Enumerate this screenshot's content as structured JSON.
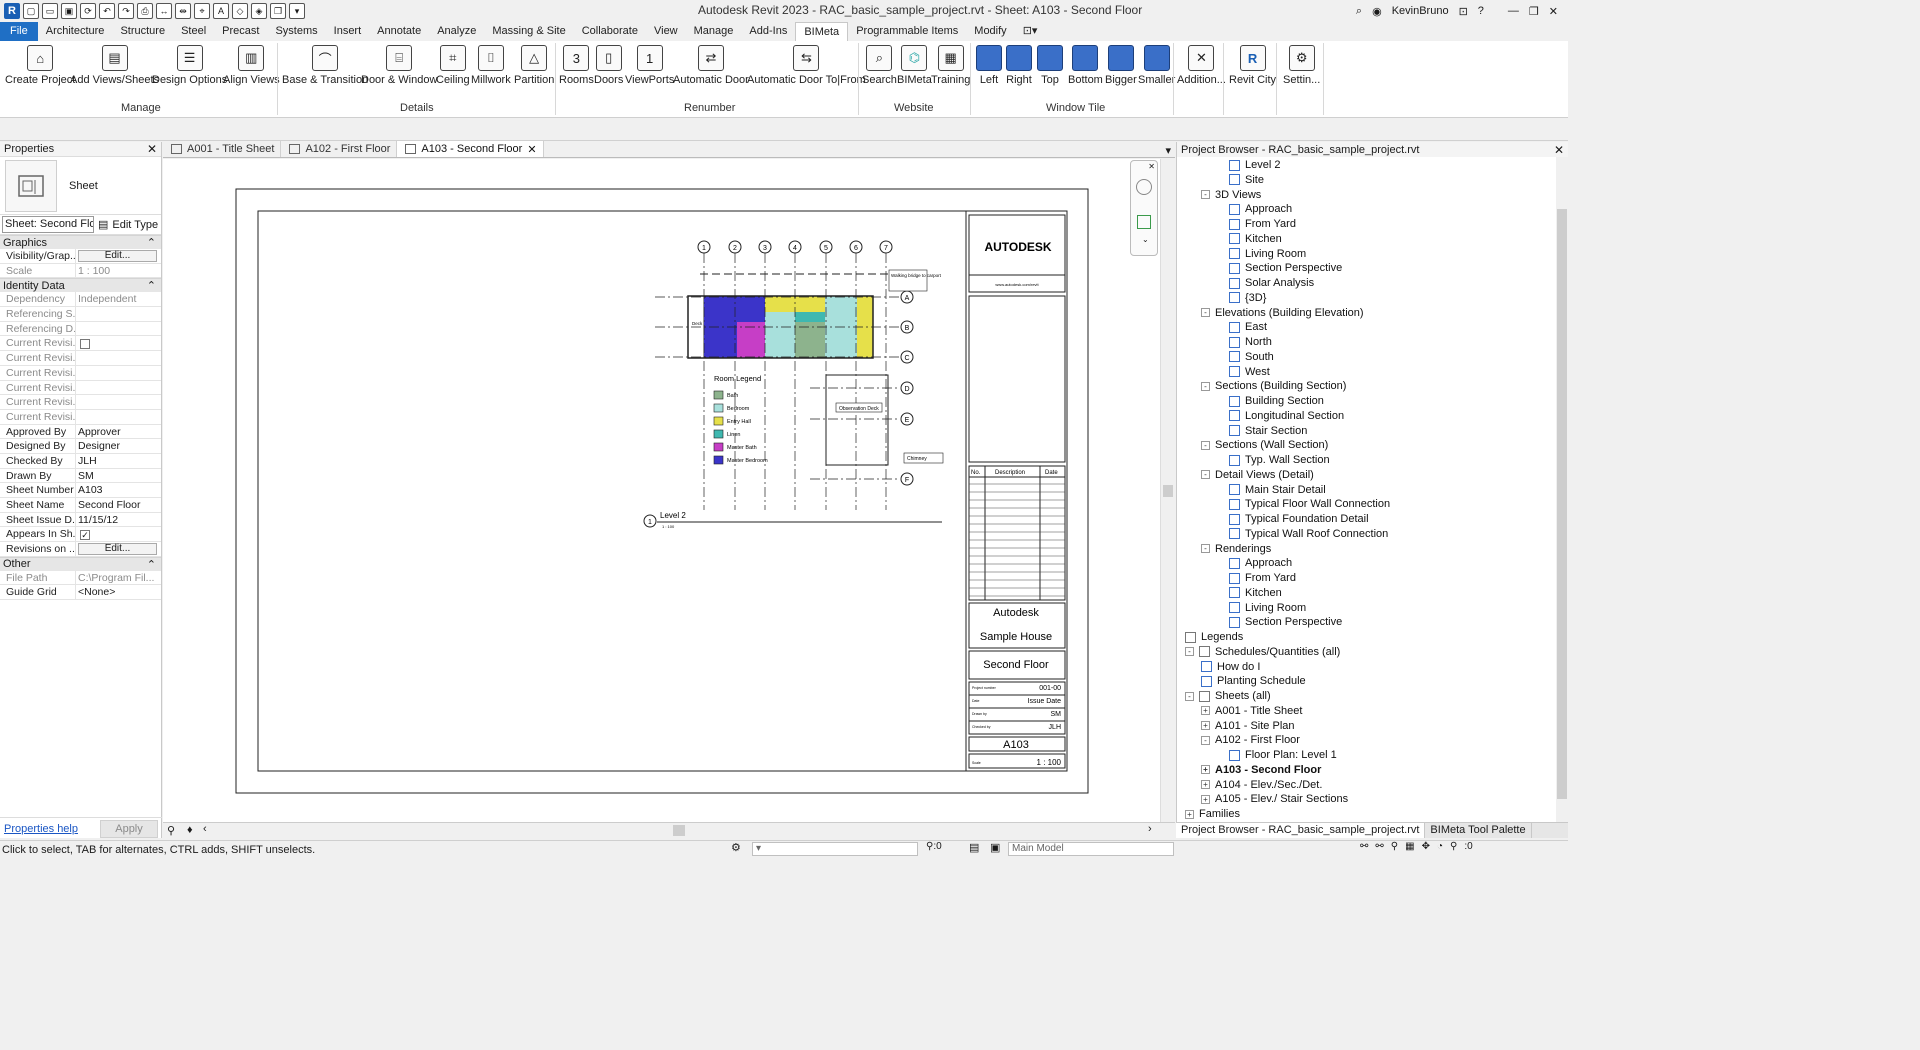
{
  "title_bar": {
    "title": "Autodesk Revit 2023 - RAC_basic_sample_project.rvt - Sheet: A103 - Second Floor",
    "user": "KevinBruno"
  },
  "menu": [
    "File",
    "Architecture",
    "Structure",
    "Steel",
    "Precast",
    "Systems",
    "Insert",
    "Annotate",
    "Analyze",
    "Massing & Site",
    "Collaborate",
    "View",
    "Manage",
    "Add-Ins",
    "BIMeta",
    "Programmable Items",
    "Modify"
  ],
  "ribbon": {
    "buttons": {
      "create_project": "Create Project",
      "add_views_sheets": "Add Views/Sheets",
      "design_options": "Design Options",
      "align_views": "Align Views",
      "base_transition": "Base & Transition",
      "door_window": "Door & Window",
      "ceiling": "Ceiling",
      "millwork": "Millwork",
      "partition": "Partition",
      "rooms": "Rooms",
      "doors": "Doors",
      "viewports": "ViewPorts",
      "automatic_door": "Automatic Door",
      "automatic_door_to_from": "Automatic Door To|From",
      "search": "Search",
      "bimeta": "BIMeta",
      "training": "Training",
      "left": "Left",
      "right": "Right",
      "top": "Top",
      "bottom": "Bottom",
      "bigger": "Bigger",
      "smaller": "Smaller",
      "addition": "Addition...",
      "revit_city": "Revit City",
      "settings": "Settin..."
    },
    "panels": {
      "manage": "Manage",
      "details": "Details",
      "renumber": "Renumber",
      "website": "Website",
      "window_tile": "Window Tile"
    }
  },
  "properties": {
    "header": "Properties",
    "type_name": "Sheet",
    "type_selector": "Sheet: Second Flo",
    "edit_type": "Edit Type",
    "groups": {
      "graphics": "Graphics",
      "identity": "Identity Data",
      "other": "Other"
    },
    "graphics_rows": [
      {
        "k": "Visibility/Grap...",
        "v": "Edit...",
        "btn": true
      },
      {
        "k": "Scale",
        "v": "1 : 100",
        "dim": true
      }
    ],
    "identity_rows": [
      {
        "k": "Dependency",
        "v": "Independent",
        "dim": true
      },
      {
        "k": "Referencing S...",
        "v": "",
        "dim": true
      },
      {
        "k": "Referencing D...",
        "v": "",
        "dim": true
      },
      {
        "k": "Current Revisi...",
        "v": "",
        "dim": true,
        "check": true
      },
      {
        "k": "Current Revisi...",
        "v": "",
        "dim": true
      },
      {
        "k": "Current Revisi...",
        "v": "",
        "dim": true
      },
      {
        "k": "Current Revisi...",
        "v": "",
        "dim": true
      },
      {
        "k": "Current Revisi...",
        "v": "",
        "dim": true
      },
      {
        "k": "Current Revisi...",
        "v": "",
        "dim": true
      },
      {
        "k": "Approved By",
        "v": "Approver"
      },
      {
        "k": "Designed By",
        "v": "Designer"
      },
      {
        "k": "Checked By",
        "v": "JLH"
      },
      {
        "k": "Drawn By",
        "v": "SM"
      },
      {
        "k": "Sheet Number",
        "v": "A103"
      },
      {
        "k": "Sheet Name",
        "v": "Second Floor"
      },
      {
        "k": "Sheet Issue D...",
        "v": "11/15/12"
      },
      {
        "k": "Appears In Sh...",
        "v": "",
        "check": true,
        "checked": true
      },
      {
        "k": "Revisions on ...",
        "v": "Edit...",
        "btn": true
      }
    ],
    "other_rows": [
      {
        "k": "File Path",
        "v": "C:\\Program Fil...",
        "dim": true
      },
      {
        "k": "Guide Grid",
        "v": "<None>"
      }
    ],
    "help_link": "Properties help",
    "apply": "Apply"
  },
  "view_tabs": [
    {
      "label": "A001 - Title Sheet",
      "active": false
    },
    {
      "label": "A102 - First Floor",
      "active": false
    },
    {
      "label": "A103 - Second Floor",
      "active": true
    }
  ],
  "sheet": {
    "brand": "AUTODESK",
    "url": "www.autodesk.com/revit",
    "rev_headers": [
      "No.",
      "Description",
      "Date"
    ],
    "company": "Autodesk",
    "project": "Sample House",
    "sheet_name": "Second Floor",
    "project_number_label": "Project number",
    "project_number": "001-00",
    "date_label": "Date",
    "date": "Issue Date",
    "drawn_by_label": "Drawn by",
    "drawn_by": "SM",
    "checked_by_label": "Checked by",
    "checked_by": "JLH",
    "sheet_number": "A103",
    "scale_label": "Scale",
    "scale": "1 : 100",
    "level_label": "Level 2",
    "level_scale": "1 : 100",
    "level_num": "1",
    "grid_numbers": [
      "1",
      "2",
      "3",
      "4",
      "5",
      "6",
      "7"
    ],
    "grid_letters": [
      "A",
      "B",
      "C",
      "D",
      "E",
      "F"
    ],
    "legend_title": "Room  Legend",
    "legend": [
      {
        "name": "Bath",
        "color": "#8db38d"
      },
      {
        "name": "Bedroom",
        "color": "#a8e0dc"
      },
      {
        "name": "Entry Hall",
        "color": "#e6e04a"
      },
      {
        "name": "Linen",
        "color": "#3fb8b0"
      },
      {
        "name": "Master Bath",
        "color": "#c63ec6"
      },
      {
        "name": "Master Bedroom",
        "color": "#3b34c9"
      }
    ],
    "tags": {
      "walking_bridge": "Walking bridge to carport",
      "observation_deck": "Observation Deck",
      "chimney": "Chimney",
      "deck": "Deck"
    }
  },
  "browser": {
    "header": "Project Browser - RAC_basic_sample_project.rvt",
    "rows": [
      {
        "label": "Level 2",
        "level": 2,
        "icon": "view"
      },
      {
        "label": "Site",
        "level": 2,
        "icon": "view"
      },
      {
        "label": "3D Views",
        "level": 1,
        "toggle": "-"
      },
      {
        "label": "Approach",
        "level": 2,
        "icon": "view"
      },
      {
        "label": "From Yard",
        "level": 2,
        "icon": "view"
      },
      {
        "label": "Kitchen",
        "level": 2,
        "icon": "view"
      },
      {
        "label": "Living Room",
        "level": 2,
        "icon": "view"
      },
      {
        "label": "Section Perspective",
        "level": 2,
        "icon": "view"
      },
      {
        "label": "Solar Analysis",
        "level": 2,
        "icon": "view"
      },
      {
        "label": "{3D}",
        "level": 2,
        "icon": "view"
      },
      {
        "label": "Elevations (Building Elevation)",
        "level": 1,
        "toggle": "-"
      },
      {
        "label": "East",
        "level": 2,
        "icon": "view"
      },
      {
        "label": "North",
        "level": 2,
        "icon": "view"
      },
      {
        "label": "South",
        "level": 2,
        "icon": "view"
      },
      {
        "label": "West",
        "level": 2,
        "icon": "view"
      },
      {
        "label": "Sections (Building Section)",
        "level": 1,
        "toggle": "-"
      },
      {
        "label": "Building Section",
        "level": 2,
        "icon": "view"
      },
      {
        "label": "Longitudinal Section",
        "level": 2,
        "icon": "view"
      },
      {
        "label": "Stair Section",
        "level": 2,
        "icon": "view"
      },
      {
        "label": "Sections (Wall Section)",
        "level": 1,
        "toggle": "-"
      },
      {
        "label": "Typ. Wall Section",
        "level": 2,
        "icon": "view"
      },
      {
        "label": "Detail Views (Detail)",
        "level": 1,
        "toggle": "-"
      },
      {
        "label": "Main Stair Detail",
        "level": 2,
        "icon": "view"
      },
      {
        "label": "Typical Floor Wall Connection",
        "level": 2,
        "icon": "view"
      },
      {
        "label": "Typical Foundation Detail",
        "level": 2,
        "icon": "view"
      },
      {
        "label": "Typical Wall Roof Connection",
        "level": 2,
        "icon": "view"
      },
      {
        "label": "Renderings",
        "level": 1,
        "toggle": "-"
      },
      {
        "label": "Approach",
        "level": 2,
        "icon": "view"
      },
      {
        "label": "From Yard",
        "level": 2,
        "icon": "view"
      },
      {
        "label": "Kitchen",
        "level": 2,
        "icon": "view"
      },
      {
        "label": "Living Room",
        "level": 2,
        "icon": "view"
      },
      {
        "label": "Section Perspective",
        "level": 2,
        "icon": "view"
      },
      {
        "label": "Legends",
        "level": 0,
        "icon": "table"
      },
      {
        "label": "Schedules/Quantities (all)",
        "level": 0,
        "toggle": "-",
        "icon": "table"
      },
      {
        "label": "How do I",
        "level": 1,
        "icon": "view"
      },
      {
        "label": "Planting Schedule",
        "level": 1,
        "icon": "view"
      },
      {
        "label": "Sheets (all)",
        "level": 0,
        "toggle": "-",
        "icon": "table"
      },
      {
        "label": "A001 - Title Sheet",
        "level": 1,
        "toggle": "+"
      },
      {
        "label": "A101 - Site Plan",
        "level": 1,
        "toggle": "+"
      },
      {
        "label": "A102 - First Floor",
        "level": 1,
        "toggle": "-"
      },
      {
        "label": "Floor Plan: Level 1",
        "level": 2,
        "icon": "view"
      },
      {
        "label": "A103 - Second Floor",
        "level": 1,
        "toggle": "+",
        "bold": true
      },
      {
        "label": "A104 - Elev./Sec./Det.",
        "level": 1,
        "toggle": "+"
      },
      {
        "label": "A105 - Elev./ Stair Sections",
        "level": 1,
        "toggle": "+"
      },
      {
        "label": "Families",
        "level": 0,
        "toggle": "+"
      }
    ],
    "tabs": [
      "Project Browser - RAC_basic_sample_project.rvt",
      "BIMeta Tool Palette"
    ]
  },
  "status": {
    "message": "Click to select, TAB for alternates, CTRL adds, SHIFT unselects.",
    "selection_count": ":0",
    "model": "Main Model",
    "filter_count": ":0"
  }
}
